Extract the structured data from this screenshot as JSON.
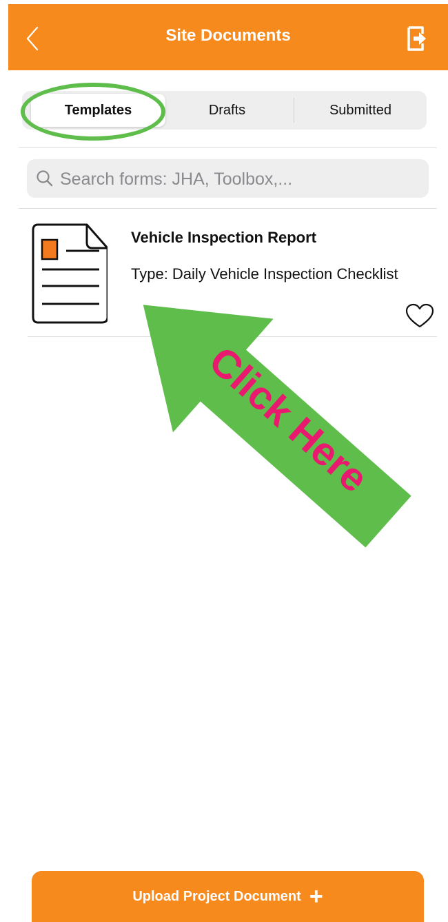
{
  "header": {
    "title": "Site Documents",
    "back_icon": "chevron-left-icon",
    "exit_icon": "exit-icon"
  },
  "tabs": [
    {
      "label": "Templates",
      "active": true
    },
    {
      "label": "Drafts",
      "active": false
    },
    {
      "label": "Submitted",
      "active": false
    }
  ],
  "search": {
    "placeholder": "Search forms: JHA, Toolbox,..."
  },
  "documents": [
    {
      "title": "Vehicle Inspection Report",
      "type": "Type: Daily Vehicle Inspection Checklist",
      "icon": "document-icon",
      "favorite": false
    }
  ],
  "annotation": {
    "text": "Click Here"
  },
  "footer": {
    "upload_label": "Upload Project Document",
    "upload_plus": "+"
  },
  "colors": {
    "brand_orange": "#F78A1D",
    "highlight_green": "#5FBE4B",
    "annotation_pink": "#E8196E"
  }
}
